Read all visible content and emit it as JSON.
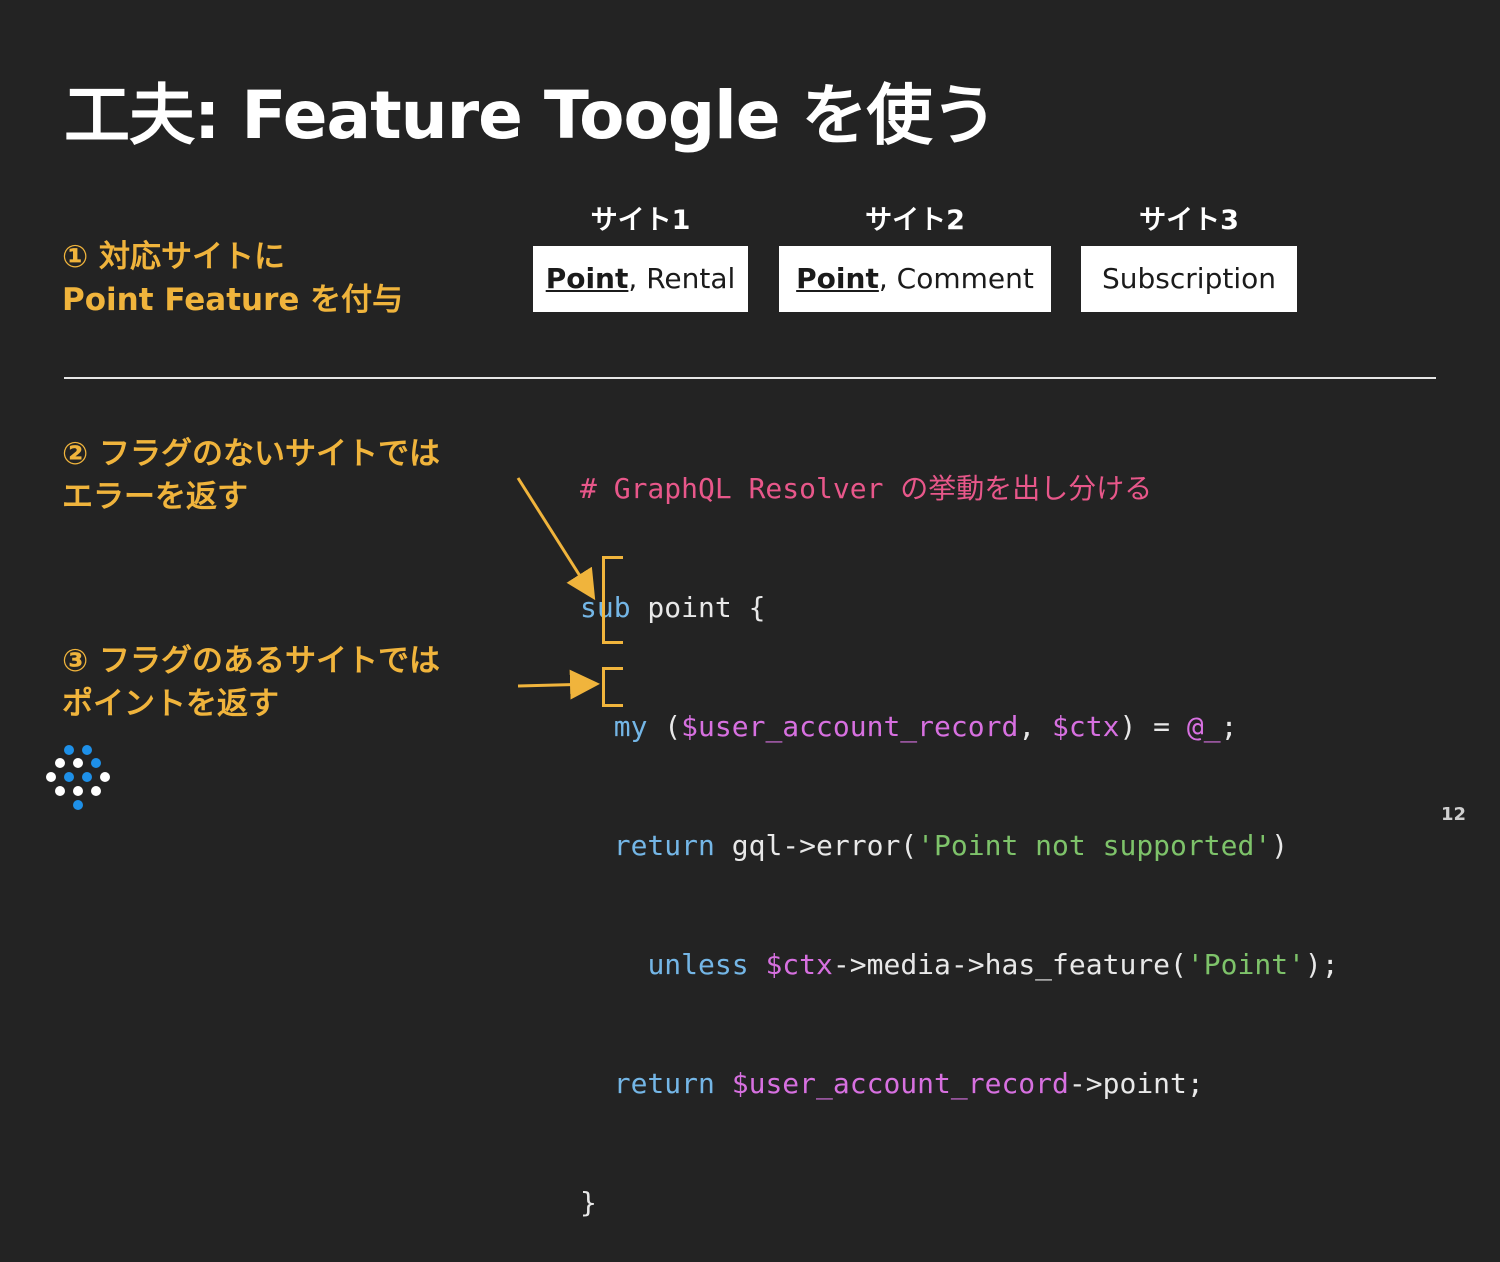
{
  "slide": {
    "title": "工夫: Feature Toogle を使う",
    "page_number": "12"
  },
  "notes": {
    "step1_line1": "① 対応サイトに",
    "step1_line2": "Point Feature を付与",
    "step2_line1": "② フラグのないサイトでは",
    "step2_line2": "エラーを返す",
    "step3_line1": "③ フラグのあるサイトでは",
    "step3_line2": "ポイントを返す"
  },
  "sites": [
    {
      "label": "サイト1",
      "highlight": "Point",
      "rest": ", Rental"
    },
    {
      "label": "サイト2",
      "highlight": "Point",
      "rest": ", Comment"
    },
    {
      "label": "サイト3",
      "highlight": "",
      "rest": "Subscription"
    }
  ],
  "code": {
    "comment": "# GraphQL Resolver の挙動を出し分ける",
    "l2_kw": "sub",
    "l2_rest": " point {",
    "l3_kw": "my",
    "l3_open": " (",
    "l3_var1": "$user_account_record",
    "l3_comma": ", ",
    "l3_var2": "$ctx",
    "l3_eq": ") = ",
    "l3_var3": "@_",
    "l3_end": ";",
    "l4_kw": "return",
    "l4_mid": " gql->error(",
    "l4_str": "'Point not supported'",
    "l4_end": ")",
    "l5_kw": "unless",
    "l5_sp": " ",
    "l5_var": "$ctx",
    "l5_mid": "->media->has_feature(",
    "l5_str": "'Point'",
    "l5_end": ");",
    "l6_kw": "return",
    "l6_sp": " ",
    "l6_var": "$user_account_record",
    "l6_end": "->point;",
    "l7": "}"
  },
  "colors": {
    "background": "#232323",
    "accent": "#f0b43c",
    "keyword": "#74b6e6",
    "variable": "#d770e0",
    "string": "#7ec36a",
    "comment": "#e8578a",
    "logo_blue": "#1e90e8"
  },
  "icons": {
    "logo": "dot-diamond-logo-icon"
  }
}
